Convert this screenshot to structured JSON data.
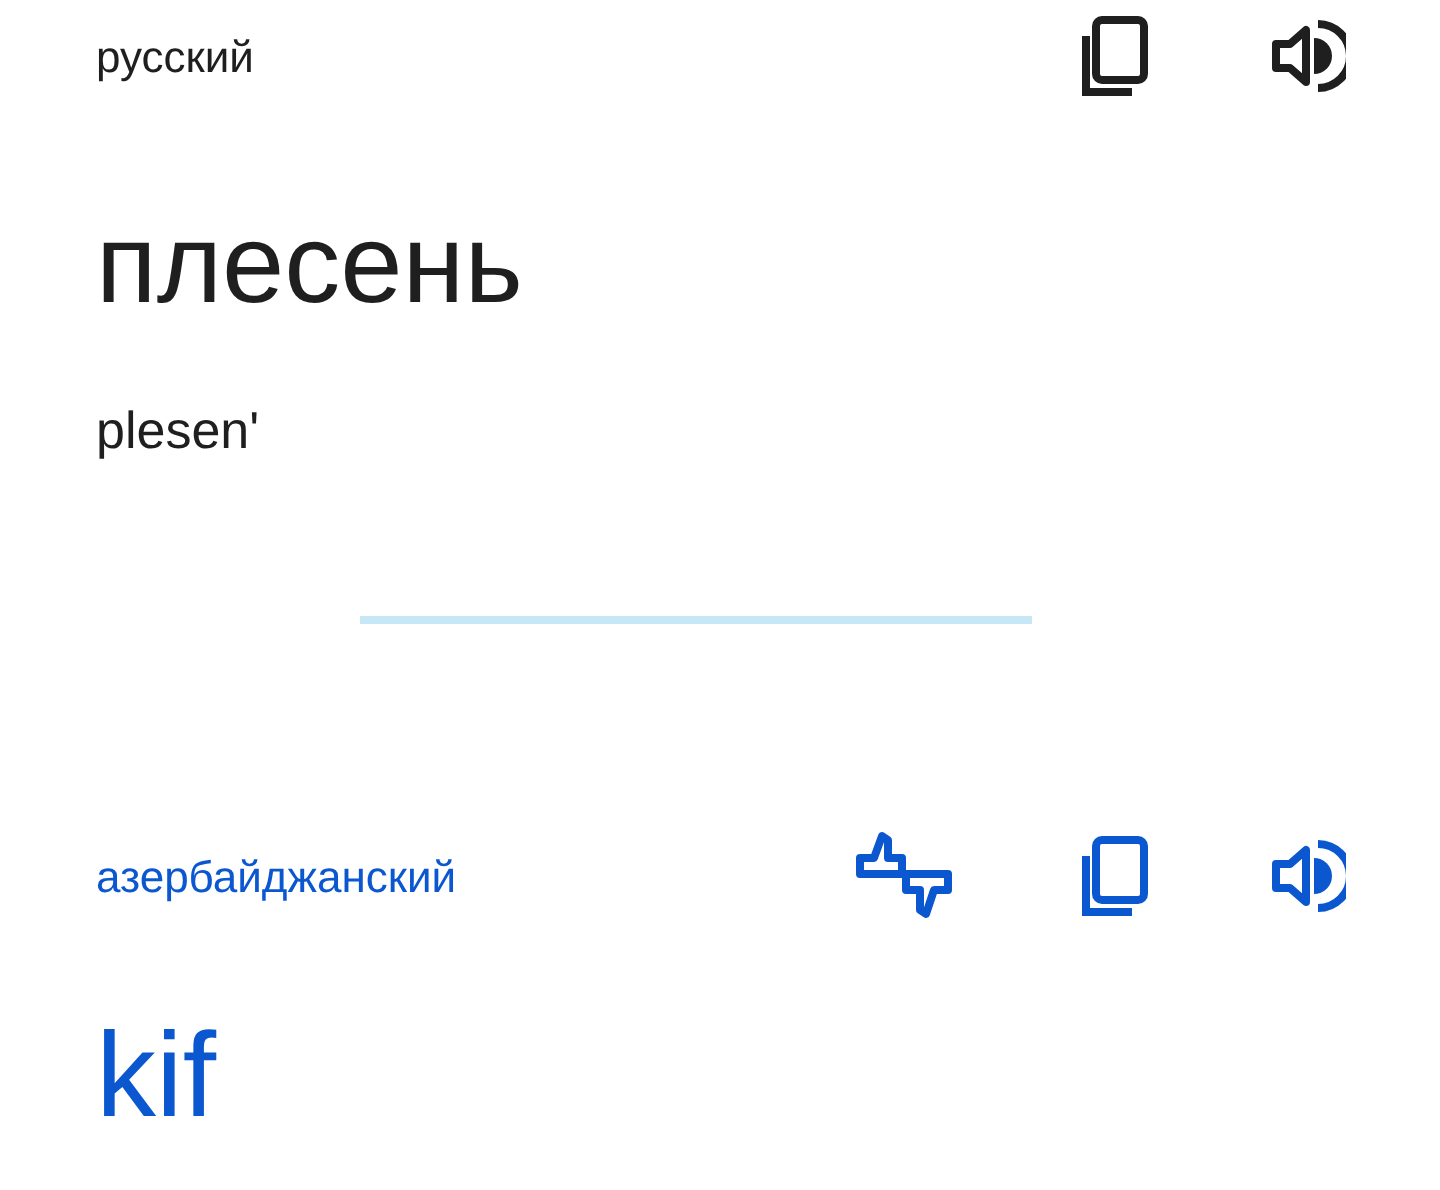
{
  "source": {
    "language": "русский",
    "text": "плесень",
    "transliteration": "plesen'"
  },
  "target": {
    "language": "азербайджанский",
    "text": "kif"
  }
}
